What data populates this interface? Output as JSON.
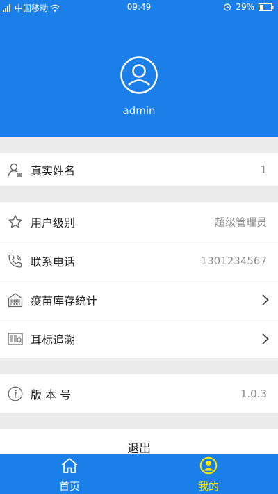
{
  "status_bar": {
    "carrier": "中国移动",
    "time": "09:49",
    "battery": "29%"
  },
  "profile": {
    "username": "admin"
  },
  "rows": [
    {
      "label": "真实姓名",
      "value": "1"
    },
    {
      "label": "用户级别",
      "value": "超级管理员"
    },
    {
      "label": "联系电话",
      "value": "1301234567"
    },
    {
      "label": "疫苗库存统计"
    },
    {
      "label": "耳标追溯"
    },
    {
      "label": "版 本 号",
      "value": "1.0.3"
    }
  ],
  "logout_label": "退出",
  "tabs": [
    {
      "label": "首页",
      "active": false
    },
    {
      "label": "我的",
      "active": true
    }
  ],
  "colors": {
    "primary": "#1a7fe8",
    "active_tab": "#ffe600",
    "background": "#ececec"
  }
}
